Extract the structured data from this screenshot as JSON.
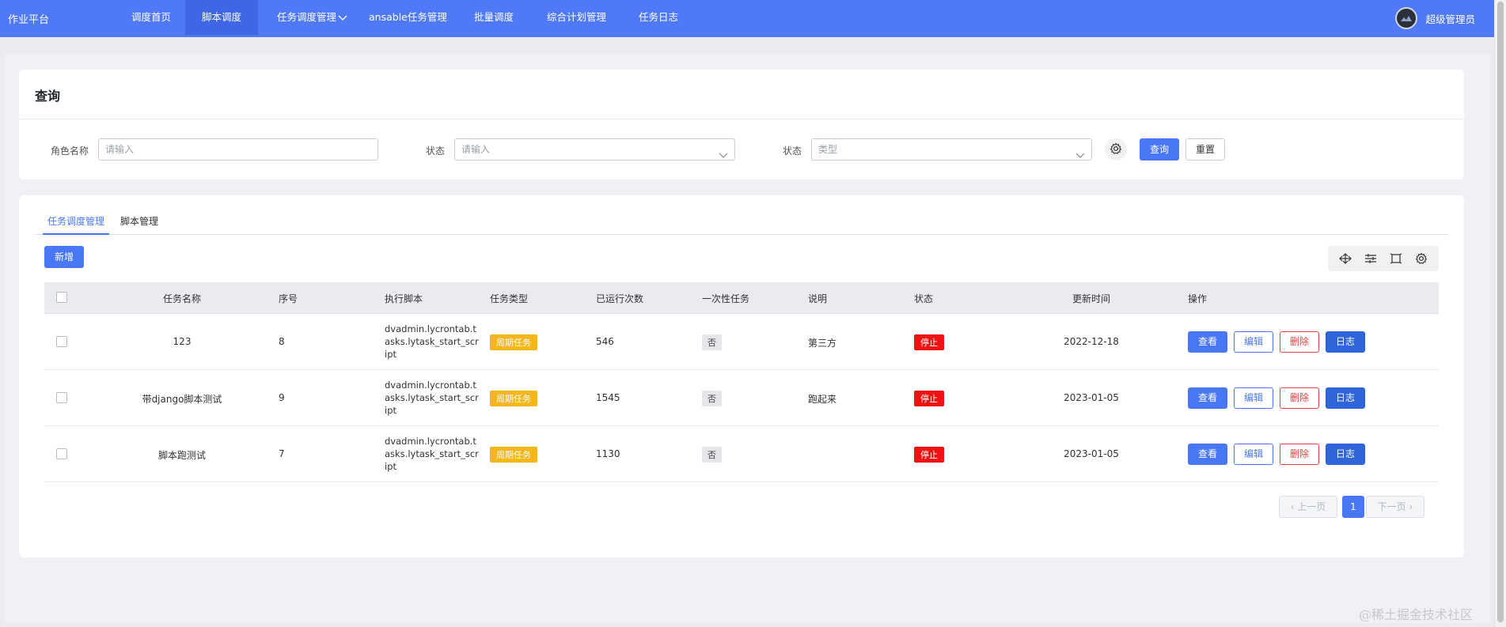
{
  "nav": {
    "brand": "作业平台",
    "items": [
      "调度首页",
      "脚本调度",
      "任务调度管理",
      "ansable任务管理",
      "批量调度",
      "综合计划管理",
      "任务日志"
    ],
    "active_index": 1,
    "user_name": "超级管理员"
  },
  "query": {
    "title": "查询",
    "fields": [
      {
        "label": "角色名称",
        "placeholder": "请输入"
      },
      {
        "label": "状态",
        "placeholder": "请输入"
      },
      {
        "label": "状态",
        "placeholder": "类型"
      }
    ],
    "search_label": "查询",
    "reset_label": "重置"
  },
  "tabs": [
    "任务调度管理",
    "脚本管理"
  ],
  "add_label": "新增",
  "table": {
    "columns": [
      "任务名称",
      "序号",
      "执行脚本",
      "任务类型",
      "已运行次数",
      "一次性任务",
      "说明",
      "状态",
      "更新时间",
      "操作"
    ],
    "rows": [
      {
        "name": "123",
        "seq": "8",
        "script": "dvadmin.lycrontab.tasks.lytask_start_script",
        "type": "周期任务",
        "runs": "546",
        "once": "否",
        "desc": "第三方",
        "status": "停止",
        "updated": "2022-12-18"
      },
      {
        "name": "带django脚本测试",
        "seq": "9",
        "script": "dvadmin.lycrontab.tasks.lytask_start_script",
        "type": "周期任务",
        "runs": "1545",
        "once": "否",
        "desc": "跑起来",
        "status": "停止",
        "updated": "2023-01-05"
      },
      {
        "name": "脚本跑测试",
        "seq": "7",
        "script": "dvadmin.lycrontab.tasks.lytask_start_script",
        "type": "周期任务",
        "runs": "1130",
        "once": "否",
        "desc": "",
        "status": "停止",
        "updated": "2023-01-05"
      }
    ],
    "actions": [
      "查看",
      "编辑",
      "删除",
      "日志"
    ]
  },
  "pager": {
    "prev": "上一页",
    "current": "1",
    "next": "下一页"
  },
  "watermark": "@稀土掘金技术社区",
  "colors": {
    "primary": "#4f79f7",
    "warn": "#f6b61a",
    "danger": "#ee1212"
  }
}
